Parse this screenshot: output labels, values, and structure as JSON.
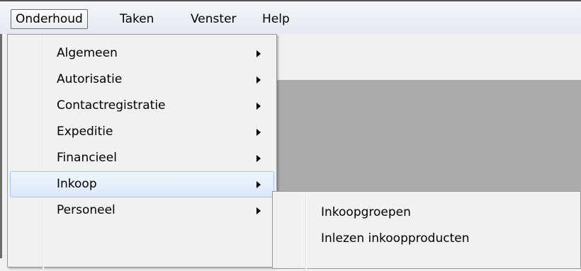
{
  "menubar": {
    "items": [
      {
        "label": "Onderhoud"
      },
      {
        "label": "Taken"
      },
      {
        "label": "Venster"
      },
      {
        "label": "Help"
      }
    ]
  },
  "dropdown": {
    "items": [
      {
        "label": "Algemeen"
      },
      {
        "label": "Autorisatie"
      },
      {
        "label": "Contactregistratie"
      },
      {
        "label": "Expeditie"
      },
      {
        "label": "Financieel"
      },
      {
        "label": "Inkoop"
      },
      {
        "label": "Personeel"
      }
    ]
  },
  "submenu": {
    "items": [
      {
        "label": "Inkoopgroepen"
      },
      {
        "label": "Inlezen inkoopproducten"
      }
    ]
  },
  "icons": {
    "submenu_arrow": "chevron-right-icon"
  }
}
